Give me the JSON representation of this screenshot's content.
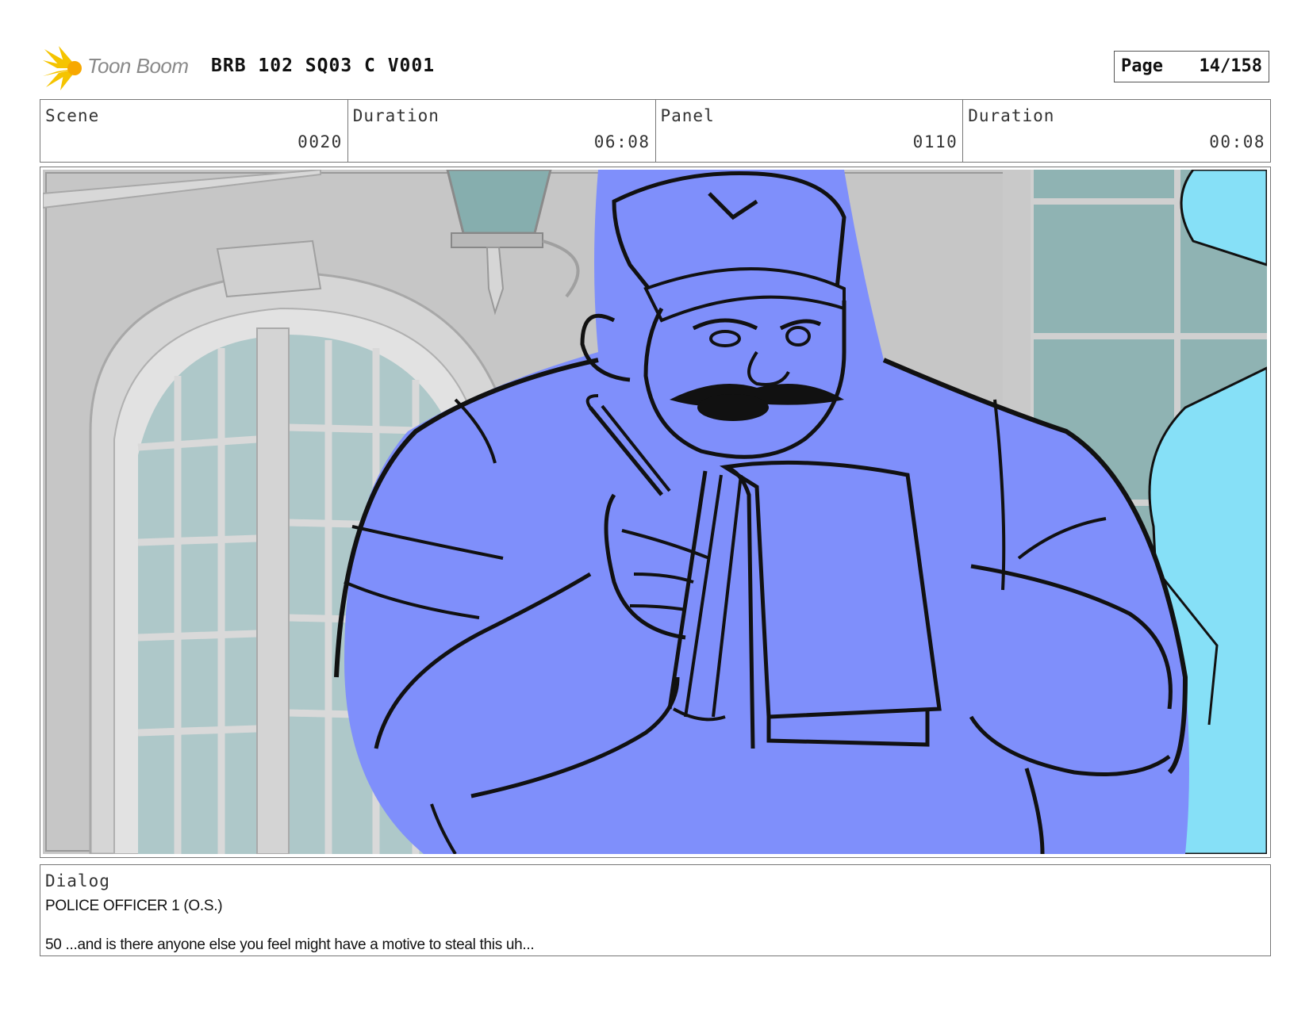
{
  "header": {
    "logo_text": "Toon Boom",
    "title": "BRB 102 SQ03 C V001",
    "page_label": "Page",
    "page_value": "14/158"
  },
  "info": {
    "scene_label": "Scene",
    "scene_value": "0020",
    "scene_duration_label": "Duration",
    "scene_duration_value": "06:08",
    "panel_label": "Panel",
    "panel_value": "0110",
    "panel_duration_label": "Duration",
    "panel_duration_value": "00:08"
  },
  "dialog": {
    "label": "Dialog",
    "speaker": "POLICE OFFICER 1 (O.S.)",
    "line": "50 ...and is there anyone else you feel might have a motive to steal this uh..."
  },
  "colors": {
    "officer_fill": "#7f8ffb",
    "background_gray": "#c4c4c4",
    "glass": "#aec8c9",
    "side_character": "#86e0f7",
    "lamp_glass": "#86aeae",
    "logo_yellow": "#f5c400"
  }
}
